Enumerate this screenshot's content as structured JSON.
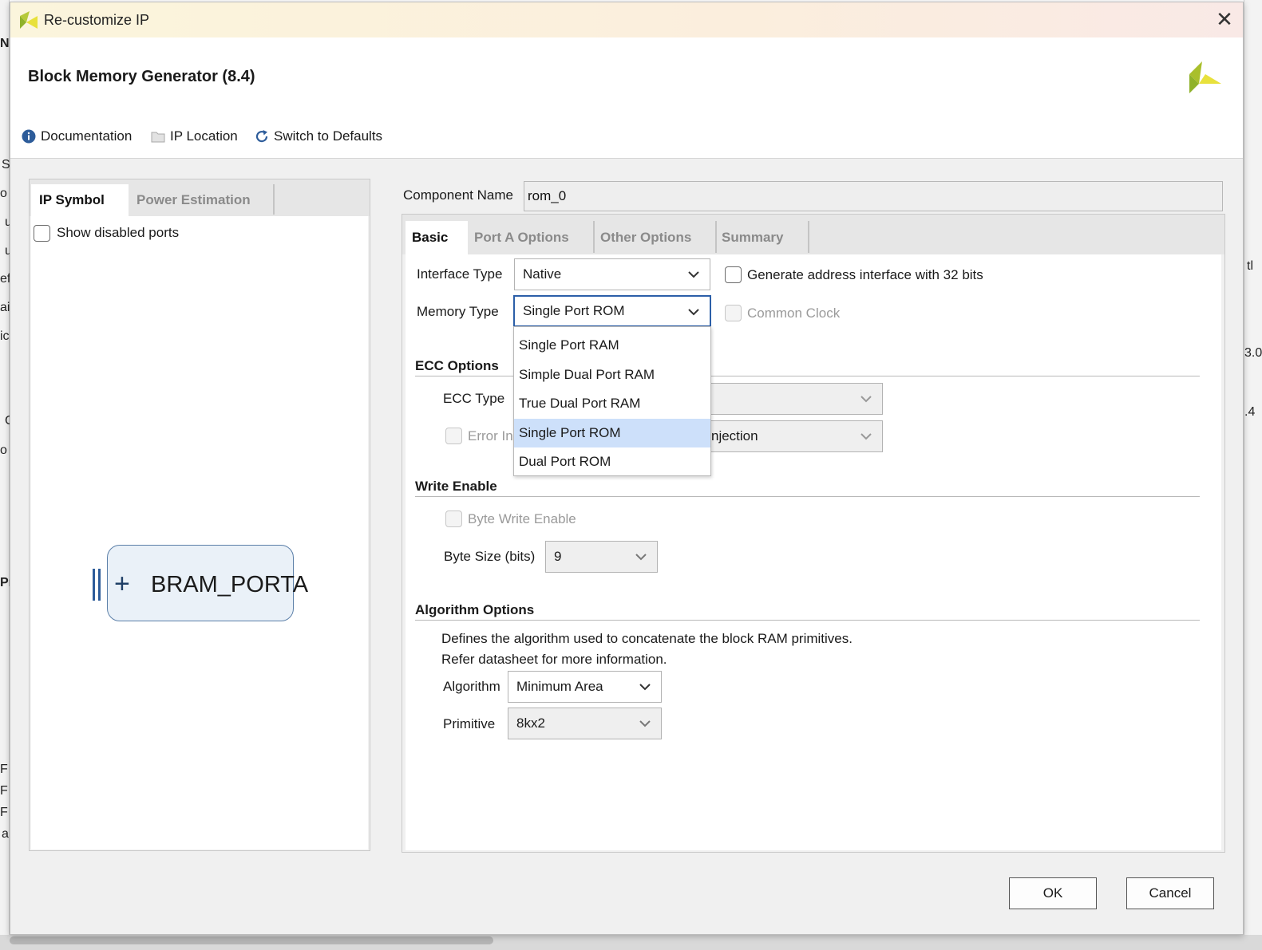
{
  "background": {
    "left_fragments": [
      "N.",
      "S",
      "o",
      "u",
      "u",
      "ef",
      "ai",
      "ic",
      "C",
      "o",
      "Pr",
      "F",
      "F",
      "F",
      "a"
    ],
    "right_fragments": [
      "tl",
      "3.0",
      ".4"
    ]
  },
  "window": {
    "title": "Re-customize IP",
    "close_glyph": "✕"
  },
  "header": {
    "title": "Block Memory Generator (8.4)",
    "toolbar": {
      "documentation": "Documentation",
      "ip_location": "IP Location",
      "switch_defaults": "Switch to Defaults"
    }
  },
  "left_panel": {
    "tabs": [
      {
        "label": "IP Symbol",
        "active": true
      },
      {
        "label": "Power Estimation",
        "active": false
      }
    ],
    "show_disabled_ports": {
      "label": "Show disabled ports",
      "checked": false
    },
    "symbol": {
      "port_label": "BRAM_PORTA",
      "plus": "+"
    }
  },
  "component": {
    "label": "Component Name",
    "value": "rom_0"
  },
  "right_tabs": [
    {
      "label": "Basic",
      "active": true
    },
    {
      "label": "Port A Options",
      "active": false
    },
    {
      "label": "Other Options",
      "active": false
    },
    {
      "label": "Summary",
      "active": false
    }
  ],
  "basic": {
    "interface_type": {
      "label": "Interface Type",
      "value": "Native"
    },
    "gen_address": {
      "label": "Generate address interface with 32 bits",
      "checked": false
    },
    "memory_type": {
      "label": "Memory Type",
      "value": "Single Port ROM",
      "options": [
        "Single Port RAM",
        "Simple Dual Port RAM",
        "True Dual Port RAM",
        "Single Port ROM",
        "Dual Port ROM"
      ],
      "selected_index": 3
    },
    "common_clock": {
      "label": "Common Clock",
      "checked": false,
      "disabled": true
    },
    "ecc": {
      "title": "ECC Options",
      "type_label": "ECC Type",
      "error_label": "Error In",
      "error_value": "njection"
    },
    "write_enable": {
      "title": "Write Enable",
      "byte_write_label": "Byte Write Enable",
      "byte_size_label": "Byte Size (bits)",
      "byte_size_value": "9"
    },
    "algorithm": {
      "title": "Algorithm Options",
      "desc_line1": "Defines the algorithm used to concatenate the block RAM primitives.",
      "desc_line2": "Refer datasheet for more information.",
      "algorithm_label": "Algorithm",
      "algorithm_value": "Minimum Area",
      "primitive_label": "Primitive",
      "primitive_value": "8kx2"
    }
  },
  "footer": {
    "ok": "OK",
    "cancel": "Cancel"
  },
  "colors": {
    "accent": "#2c5fa8",
    "selected_item": "#cde0fa",
    "logo_green": "#8fb22a",
    "logo_yellow": "#e8e13c"
  }
}
